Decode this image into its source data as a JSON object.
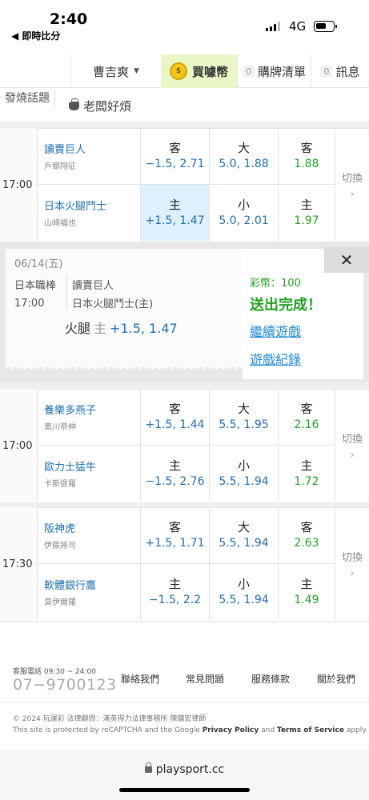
{
  "status": {
    "time": "2:40",
    "back": "◀ 即時比分",
    "network": "4G"
  },
  "nav": {
    "user": "曹吉爽",
    "buy": "買噱幣",
    "cart_count": "0",
    "cart": "購牌清單",
    "msg_count": "0",
    "msg": "訊息"
  },
  "hot": {
    "label": "發燒話題",
    "item": "老闆好煩"
  },
  "games": [
    {
      "time": "17:00",
      "home": {
        "team": "讀賣巨人",
        "pitcher": "戶鄉翔征",
        "spread_k": "客",
        "spread_v": "−1.5, 2.71",
        "total_k": "大",
        "total_v": "5.0, 1.88",
        "ml_k": "客",
        "ml_v": "1.88"
      },
      "away": {
        "team": "日本火腿鬥士",
        "pitcher": "山崎福也",
        "spread_k": "主",
        "spread_v": "+1.5, 1.47",
        "total_k": "小",
        "total_v": "5.0, 2.01",
        "ml_k": "主",
        "ml_v": "1.97"
      },
      "switch": "切換"
    },
    {
      "time": "17:00",
      "home": {
        "team": "養樂多燕子",
        "pitcher": "奧川恭伸",
        "spread_k": "客",
        "spread_v": "+1.5, 1.44",
        "total_k": "大",
        "total_v": "5.5, 1.95",
        "ml_k": "客",
        "ml_v": "2.16"
      },
      "away": {
        "team": "歐力士猛牛",
        "pitcher": "卡斯提羅",
        "spread_k": "主",
        "spread_v": "−1.5, 2.76",
        "total_k": "小",
        "total_v": "5.5, 1.94",
        "ml_k": "主",
        "ml_v": "1.72"
      },
      "switch": "切換"
    },
    {
      "time": "17:30",
      "home": {
        "team": "阪神虎",
        "pitcher": "伊藤將司",
        "spread_k": "客",
        "spread_v": "+1.5, 1.71",
        "total_k": "大",
        "total_v": "5.5, 1.94",
        "ml_k": "客",
        "ml_v": "2.63"
      },
      "away": {
        "team": "軟體銀行鷹",
        "pitcher": "莫伊爾羅",
        "spread_k": "主",
        "spread_v": "−1.5, 2.2",
        "total_k": "小",
        "total_v": "5.5, 1.94",
        "ml_k": "主",
        "ml_v": "1.49"
      },
      "switch": "切換"
    }
  ],
  "panel": {
    "date": "06/14(五)",
    "league": "日本職棒",
    "time": "17:00",
    "team1": "讀賣巨人",
    "team2": "日本火腿鬥士(主)",
    "bet_team": "火腿",
    "bet_side": "主",
    "bet_value": "+1.5, 1.47",
    "coins": "彩幣：100",
    "done": "送出完成！",
    "continue": "繼續遊戲",
    "history": "遊戲紀錄",
    "close": "✕"
  },
  "footer": {
    "hours": "客服電話 09:30 ~ 24:00",
    "phone": "07−9700123",
    "links": [
      "聯絡我們",
      "常見問題",
      "服務條款",
      "關於我們"
    ],
    "copyright": "© 2024 玩運彩 法律顧問：漢英得力法律事務所 陳鎮宏律師",
    "recaptcha_pre": "This site is protected by reCAPTCHA and the Google",
    "privacy": "Privacy Policy",
    "and": "and",
    "terms": "Terms of Service",
    "apply": "apply.",
    "url": "playsport.cc"
  }
}
